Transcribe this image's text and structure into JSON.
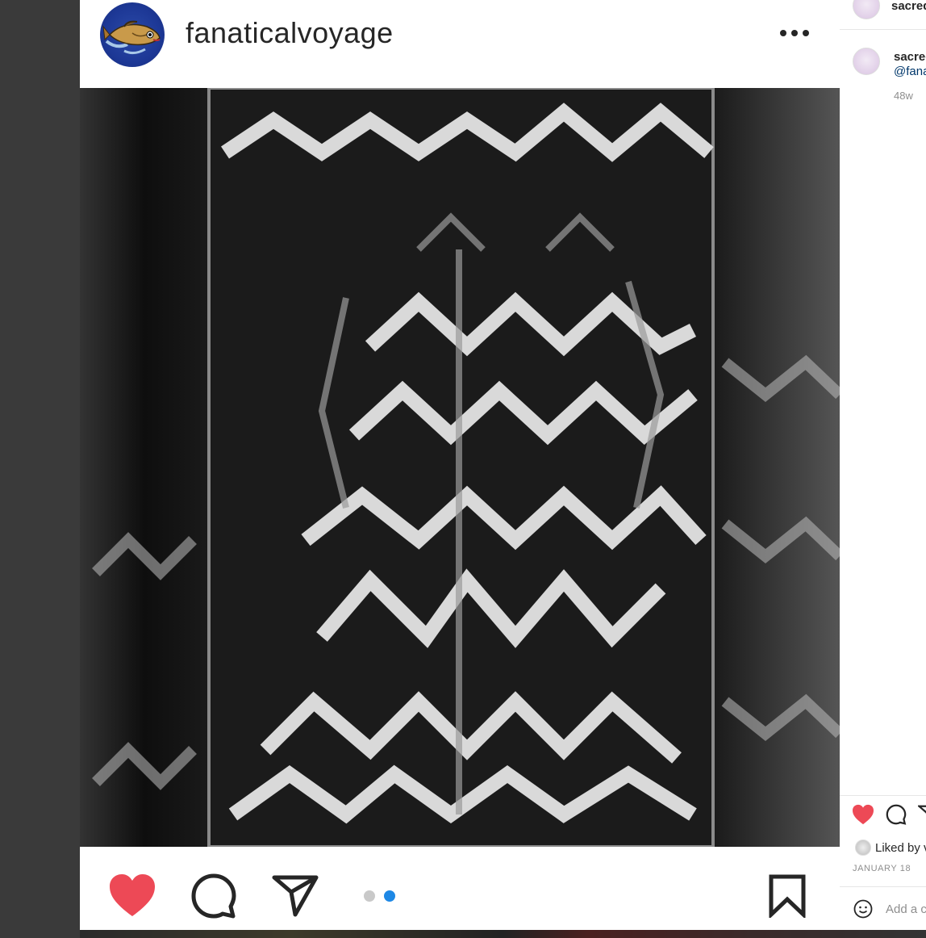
{
  "post": {
    "username": "fanaticalvoyage",
    "carousel": {
      "count": 2,
      "active_index": 2
    }
  },
  "side_panel": {
    "top_username": "sacred",
    "comment_username": "sacrec",
    "comment_mention": "@fana",
    "comment_time": "48w",
    "liked_by": "Liked by v",
    "date": "JANUARY 18",
    "add_comment_placeholder": "Add a c"
  },
  "colors": {
    "like_red": "#ed4956",
    "active_dot": "#1e88e5",
    "text_primary": "#262626",
    "text_secondary": "#8e8e8e"
  },
  "icons": [
    "more-options-icon",
    "heart-icon",
    "comment-icon",
    "share-icon",
    "bookmark-icon",
    "emoji-icon"
  ]
}
